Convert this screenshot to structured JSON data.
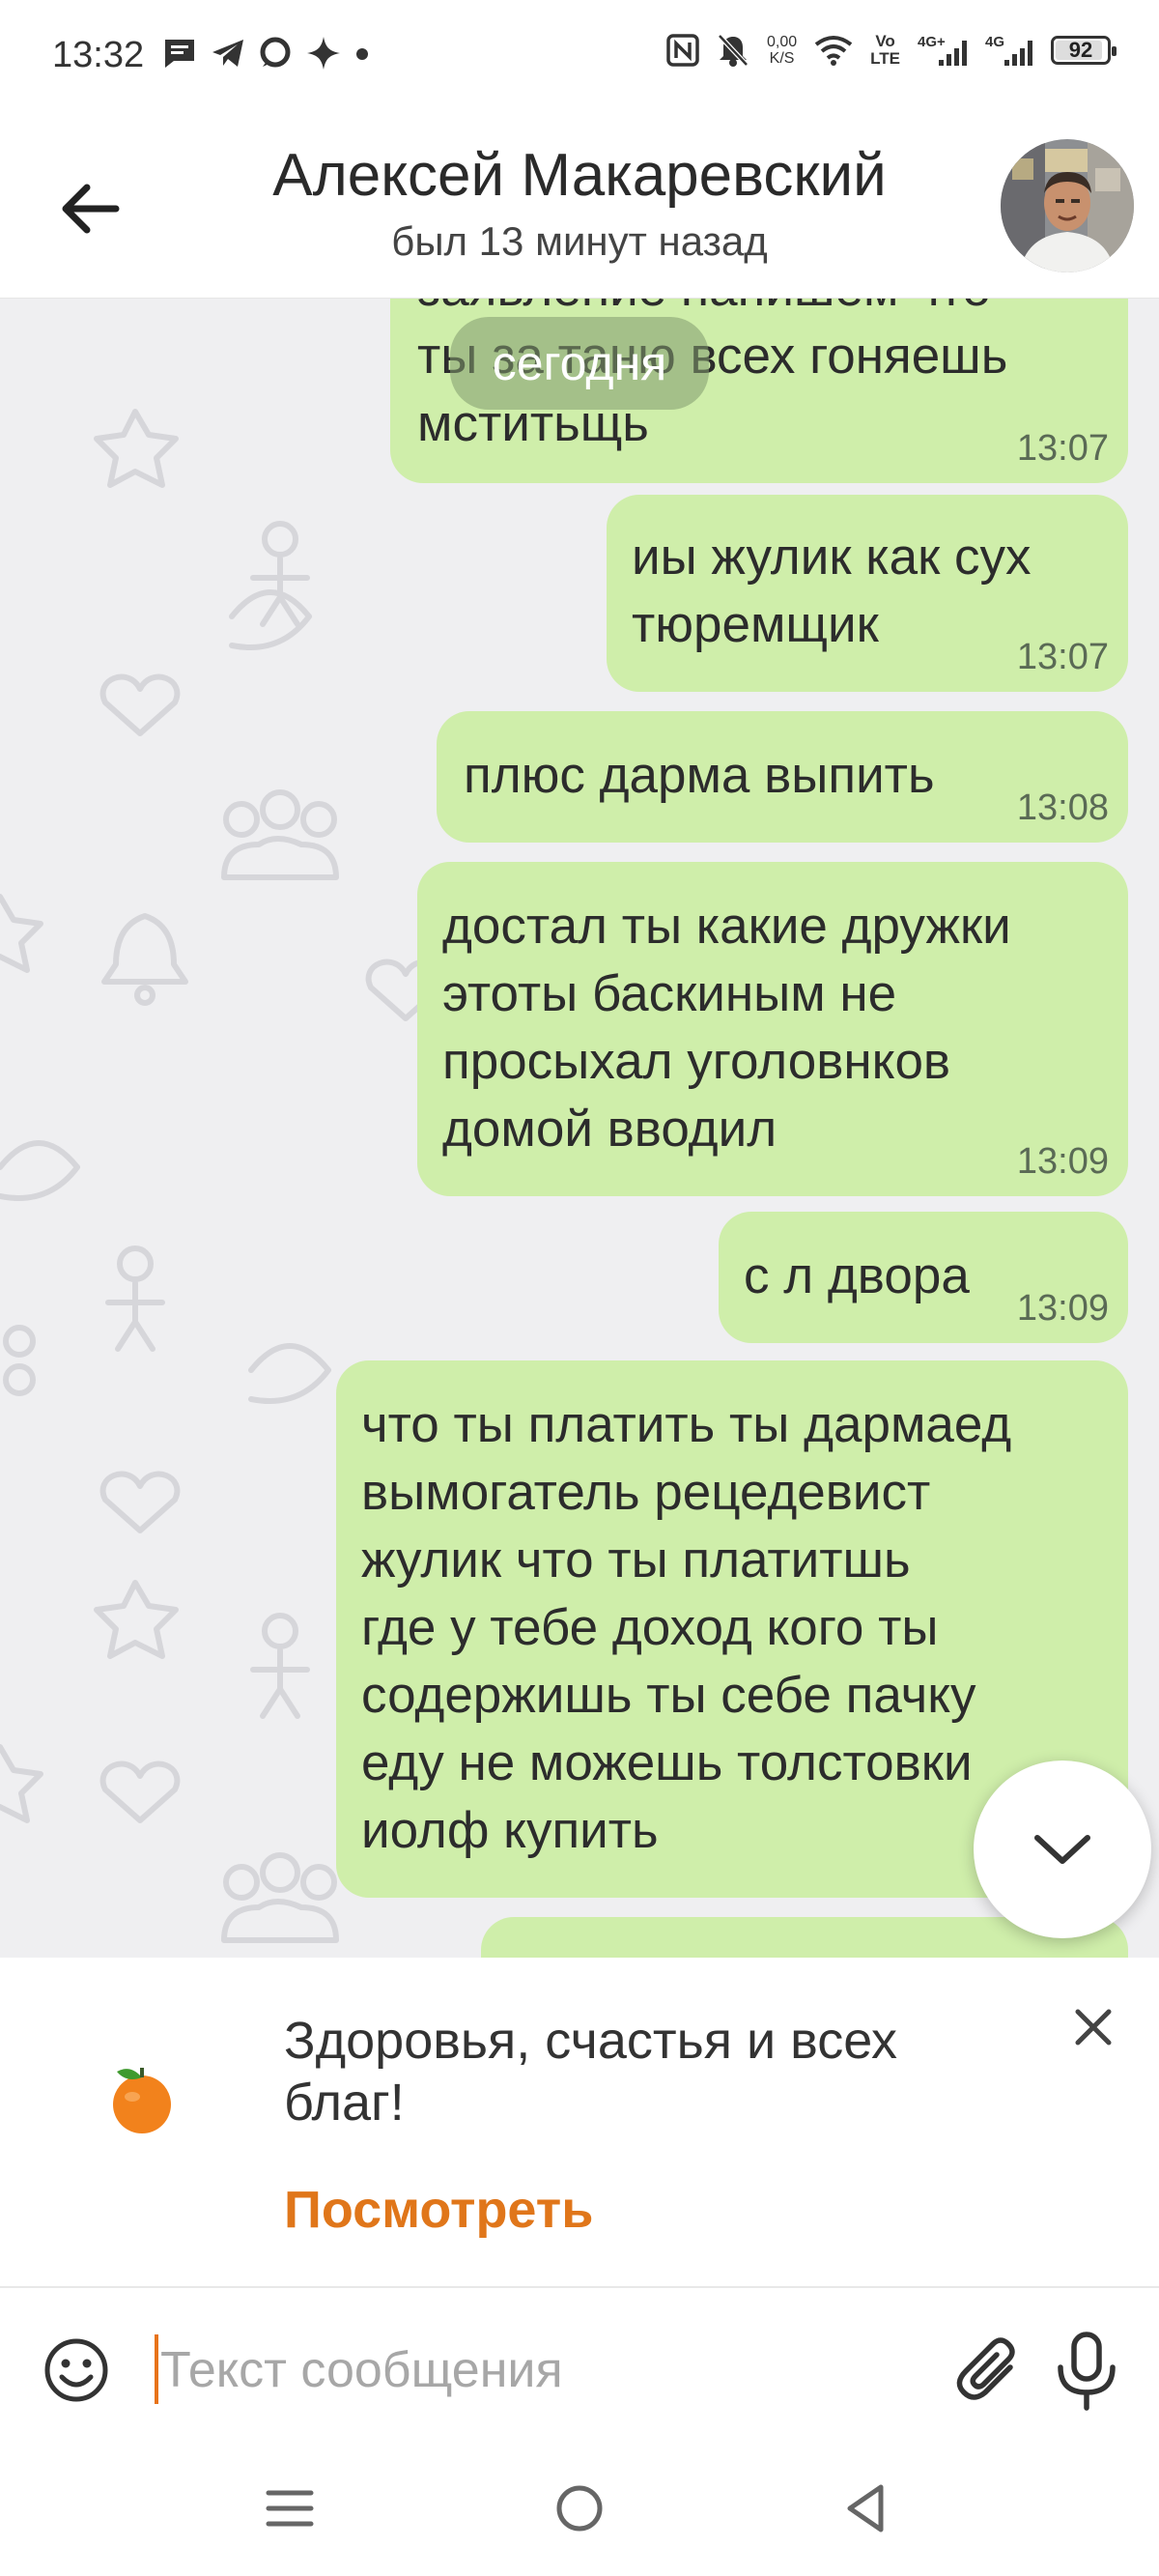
{
  "status_bar": {
    "time": "13:32",
    "net_speed_value": "0,00",
    "net_speed_unit": "K/S",
    "volte_top": "Vo",
    "volte_bottom": "LTE",
    "battery": "92",
    "battery_level": 0.92
  },
  "header": {
    "contact_name": "Алексей Макаревский",
    "contact_status": "был 13 минут назад"
  },
  "chat": {
    "date_chip": "сегодня",
    "messages": [
      {
        "text": "заявление напишем что\nты за таню всех гоняешь\nмститьщь",
        "time": "13:07"
      },
      {
        "text": "иы жулик как сух\nтюремщик",
        "time": "13:07"
      },
      {
        "text": "плюс дарма выпить",
        "time": "13:08"
      },
      {
        "text": "достал ты какие дружки\nэтоты баскиным не\nпросыхал уголовнков\nдомой вводил",
        "time": "13:09"
      },
      {
        "text": "с л двора",
        "time": "13:09"
      },
      {
        "text": "что ты платить ты дармаед\nвымогатель рецедевист\nжулик что ты платитшь\nгде у тебе доход кого ты\nсодержишь ты себе пачку\nеду не можешь толстовки\nиолф купить",
        "time": ""
      }
    ]
  },
  "promo": {
    "text": "Здоровья, счастья и всех благ!",
    "link": "Посмотреть"
  },
  "input": {
    "placeholder": "Текст сообщения"
  },
  "icons": {
    "back": "arrow-left-icon",
    "scroll": "chevron-down-icon",
    "close": "close-icon",
    "emoji": "smile-icon",
    "attach": "paperclip-icon",
    "mic": "microphone-icon",
    "promo": "tangerine-icon"
  },
  "colors": {
    "outgoing_bubble": "#cfeeaa",
    "chat_background": "#efeff1",
    "accent": "#e0761a"
  }
}
